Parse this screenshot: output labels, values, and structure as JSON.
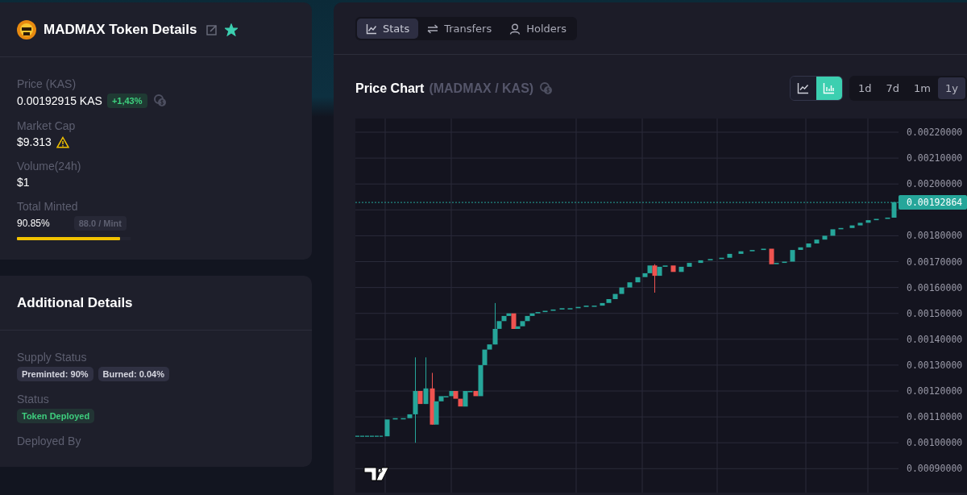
{
  "token_card": {
    "title": "MADMAX Token Details",
    "favorite": true,
    "price": {
      "label": "Price  (KAS)",
      "value": "0.00192915 KAS",
      "change": "+1,43%"
    },
    "market_cap": {
      "label": "Market Cap",
      "value": "$9.313",
      "warning": true
    },
    "volume": {
      "label": "Volume(24h)",
      "value": "$1"
    },
    "minted": {
      "label": "Total Minted",
      "value": "90.85%",
      "per_mint": "88.0 / Mint",
      "level": 0.9085
    }
  },
  "additional_details": {
    "title": "Additional Details",
    "supply_status": {
      "label": "Supply Status",
      "tags": [
        "Preminted: 90%",
        "Burned: 0.04%"
      ]
    },
    "status": {
      "label": "Status",
      "value": "Token Deployed",
      "color": "#3ecf7e"
    },
    "deployed_by": {
      "label": "Deployed By"
    }
  },
  "tabs": [
    {
      "label": "Stats",
      "kind": "stats",
      "selected": true
    },
    {
      "label": "Transfers",
      "kind": "transfers",
      "selected": false
    },
    {
      "label": "Holders",
      "kind": "holders",
      "selected": false
    }
  ],
  "price_chart": {
    "title": "Price Chart",
    "pair": "(MADMAX / KAS)",
    "chart_types": [
      {
        "kind": "line",
        "selected": false
      },
      {
        "kind": "candles",
        "selected": true
      }
    ],
    "ranges": [
      {
        "label": "1d",
        "selected": false
      },
      {
        "label": "7d",
        "selected": false
      },
      {
        "label": "1m",
        "selected": false
      },
      {
        "label": "1y",
        "selected": true
      }
    ],
    "price_axis_upper": [
      "0.00220000",
      "0.00210000",
      "0.00200000"
    ],
    "price_axis_lower": [
      "0.00180000",
      "0.00170000",
      "0.00160000",
      "0.00150000",
      "0.00140000",
      "0.00130000",
      "0.00120000",
      "0.00110000",
      "0.00100000",
      "0.00090000"
    ],
    "last_price": "0.00192864"
  }
}
